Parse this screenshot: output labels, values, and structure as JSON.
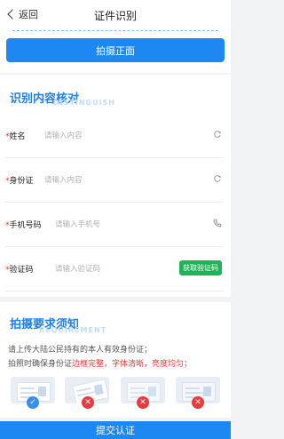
{
  "header": {
    "back_label": "返回",
    "title": "证件识别"
  },
  "top": {
    "front_button": "拍摄正面"
  },
  "verify": {
    "title": "识别内容核对",
    "subtitle": "DISTINGUISH",
    "fields": [
      {
        "label": "姓名",
        "placeholder": "请输入内容",
        "icon": "clear-icon"
      },
      {
        "label": "身份证",
        "placeholder": "请输入内容",
        "icon": "clear-icon"
      },
      {
        "label": "手机号码",
        "placeholder": "请输入手机号",
        "icon": "phone-icon"
      },
      {
        "label": "验证码",
        "placeholder": "请输入验证码",
        "button": "获取验证码"
      }
    ]
  },
  "requirements": {
    "title": "拍摄要求须知",
    "subtitle": "REQUIREMENT",
    "line1": "请上传大陆公民持有的本人有效身份证；",
    "line2_prefix": "拍照时确保身份证",
    "line2_red": "边框完整，字体清晰，亮度均匀；",
    "examples": [
      "ok",
      "no",
      "no",
      "no"
    ]
  },
  "submit": {
    "label": "提交认证"
  },
  "colors": {
    "accent": "#1e88f2",
    "required": "#e83b3b",
    "success": "#21b35a"
  }
}
